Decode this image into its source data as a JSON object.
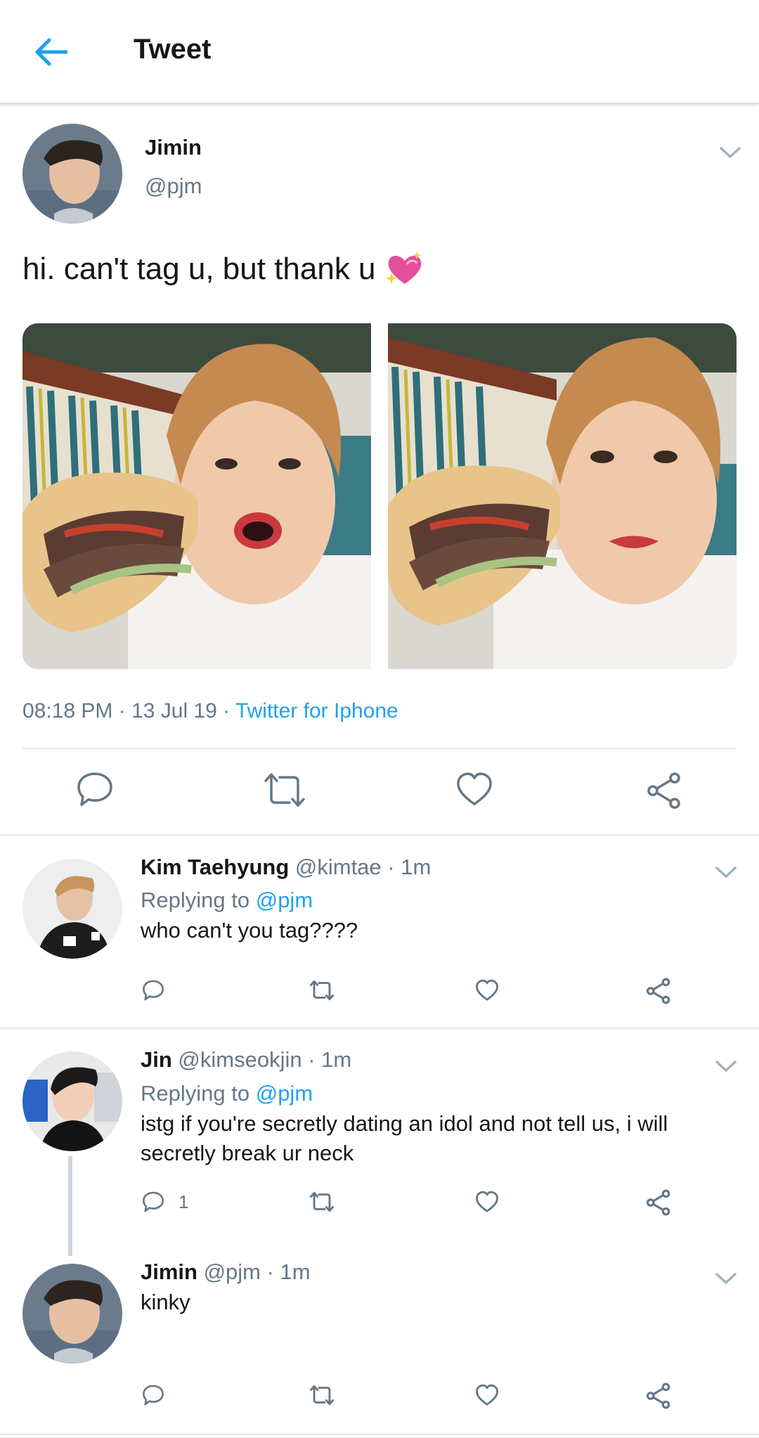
{
  "header": {
    "title": "Tweet"
  },
  "main_tweet": {
    "name": "Jimin",
    "handle": "@pjm",
    "text": "hi. can't tag u, but thank u",
    "time": "08:18 PM · 13 Jul 19 · ",
    "source": "Twitter for Iphone"
  },
  "replies": [
    {
      "name": "Kim Taehyung",
      "meta": " @kimtae · 1m",
      "replying_label": "Replying to ",
      "replying_to": "@pjm",
      "text": "who can't you tag????",
      "reply_count": ""
    },
    {
      "name": "Jin",
      "meta": " @kimseokjin · 1m",
      "replying_label": "Replying to ",
      "replying_to": "@pjm",
      "text": "istg if you're secretly dating an idol and not tell us, i will secretly break ur neck",
      "reply_count": "1"
    },
    {
      "name": "Jimin",
      "meta": " @pjm · 1m",
      "text": "kinky",
      "reply_count": ""
    }
  ],
  "colors": {
    "accent": "#1da1f2",
    "muted": "#657786",
    "text": "#14171a",
    "divider": "#e1e8ed"
  },
  "icons": [
    "back-arrow-icon",
    "chevron-down-icon",
    "reply-icon",
    "retweet-icon",
    "like-icon",
    "share-icon",
    "sparkling-heart-emoji"
  ]
}
